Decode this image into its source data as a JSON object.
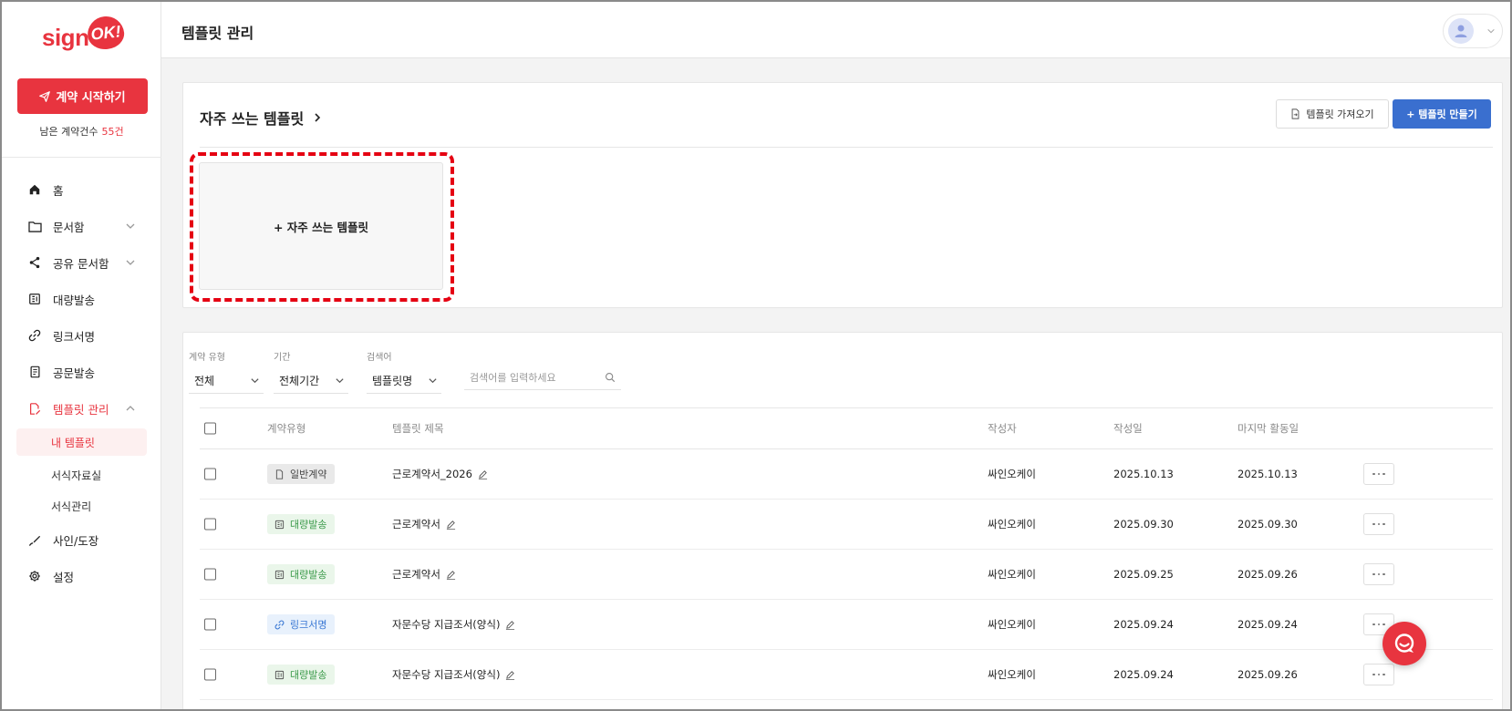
{
  "brand": {
    "logo_sign": "sign",
    "logo_ok": "OK!",
    "accent": "#e8343f",
    "primary": "#3a6fcf"
  },
  "sidebar": {
    "cta_label": "계약 시작하기",
    "remaining_label": "남은 계약건수",
    "remaining_count": "55건",
    "items": [
      {
        "label": "홈",
        "icon": "home-icon"
      },
      {
        "label": "문서함",
        "icon": "folder-icon"
      },
      {
        "label": "공유 문서함",
        "icon": "share-icon"
      },
      {
        "label": "대량발송",
        "icon": "bulk-send-icon"
      },
      {
        "label": "링크서명",
        "icon": "link-icon"
      },
      {
        "label": "공문발송",
        "icon": "document-icon"
      },
      {
        "label": "템플릿 관리",
        "icon": "template-icon"
      },
      {
        "label": "사인/도장",
        "icon": "pen-icon"
      },
      {
        "label": "설정",
        "icon": "gear-icon"
      }
    ],
    "sub_items": [
      {
        "label": "내 템플릿"
      },
      {
        "label": "서식자료실"
      },
      {
        "label": "서식관리"
      }
    ]
  },
  "header": {
    "title": "템플릿 관리"
  },
  "frequent": {
    "title": "자주 쓰는 템플릿",
    "import_label": "템플릿 가져오기",
    "create_label": "+ 템플릿 만들기",
    "add_card_label": "+ 자주 쓰는 템플릿"
  },
  "filters": {
    "type_label": "계약 유형",
    "type_value": "전체",
    "period_label": "기간",
    "period_value": "전체기간",
    "search_label": "검색어",
    "search_field": "템플릿명",
    "search_placeholder": "검색어를 입력하세요"
  },
  "table": {
    "headers": {
      "type": "계약유형",
      "title": "템플릿 제목",
      "author": "작성자",
      "created": "작성일",
      "last_active": "마지막 활동일"
    },
    "rows": [
      {
        "type": "일반계약",
        "type_kind": "general",
        "title": "근로계약서_2026",
        "author": "싸인오케이",
        "created": "2025.10.13",
        "last_active": "2025.10.13"
      },
      {
        "type": "대량발송",
        "type_kind": "bulk",
        "title": "근로계약서",
        "author": "싸인오케이",
        "created": "2025.09.30",
        "last_active": "2025.09.30"
      },
      {
        "type": "대량발송",
        "type_kind": "bulk",
        "title": "근로계약서",
        "author": "싸인오케이",
        "created": "2025.09.25",
        "last_active": "2025.09.26"
      },
      {
        "type": "링크서명",
        "type_kind": "link",
        "title": "자문수당 지급조서(양식)",
        "author": "싸인오케이",
        "created": "2025.09.24",
        "last_active": "2025.09.24"
      },
      {
        "type": "대량발송",
        "type_kind": "bulk",
        "title": "자문수당 지급조서(양식)",
        "author": "싸인오케이",
        "created": "2025.09.24",
        "last_active": "2025.09.26"
      }
    ]
  }
}
